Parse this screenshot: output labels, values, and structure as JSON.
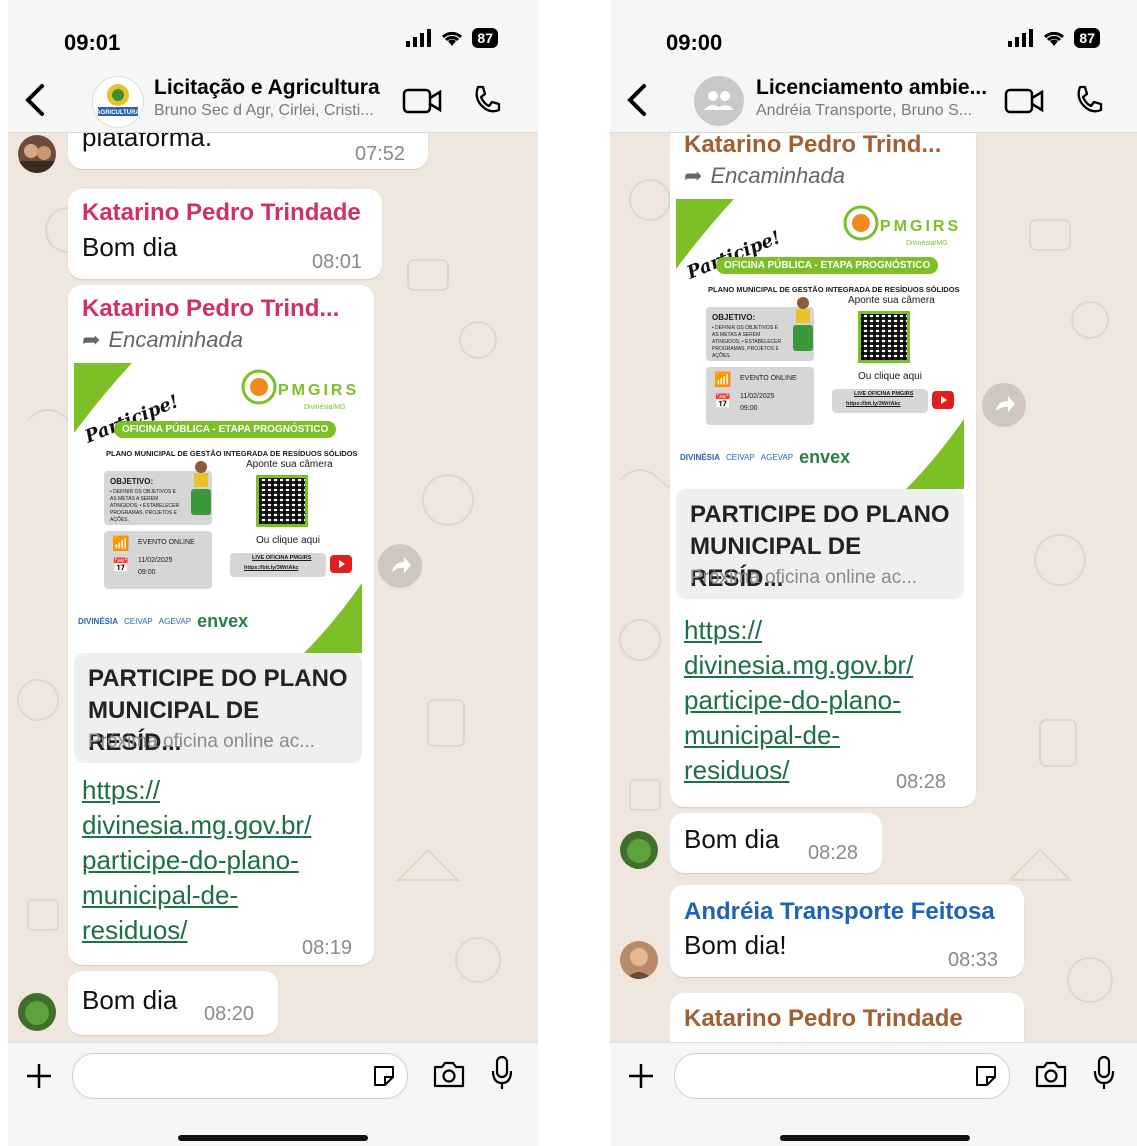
{
  "colors": {
    "accent_green": "#7dbf26",
    "link": "#1d6f45",
    "sender_pink": "#d0306a",
    "sender_blue": "#1f63b8",
    "sender_brown": "#a25f34",
    "chat_bg": "#efe7de"
  },
  "left": {
    "status": {
      "time": "09:01",
      "battery": "87"
    },
    "header": {
      "title": "Licitação e Agricultura",
      "subtitle": "Bruno Sec d Agr, Cirlei, Cristi...",
      "avatar_text": "AGRICULTURA"
    },
    "messages": {
      "m1_text": "plataforma.",
      "m1_time": "07:52",
      "m2_sender": "Katarino Pedro Trindade",
      "m2_text": "Bom dia",
      "m2_time": "08:01",
      "m3_sender": "Katarino Pedro Trind...",
      "m3_forwarded": "Encaminhada",
      "m3_link_title": "PARTICIPE DO PLANO MUNICIPAL DE RESÍD...",
      "m3_link_desc": "Próxima oficina online ac...",
      "m3_url": "https:// divinesia.mg.gov.br/ participe-do-plano- municipal-de- residuos/",
      "m3_time": "08:19",
      "m4_text": "Bom dia",
      "m4_time": "08:20"
    }
  },
  "right": {
    "status": {
      "time": "09:00",
      "battery": "87"
    },
    "header": {
      "title": "Licenciamento ambie...",
      "subtitle": "Andréia Transporte, Bruno S..."
    },
    "messages": {
      "m1_sender": "Katarino Pedro Trind...",
      "m1_forwarded": "Encaminhada",
      "m1_link_title": "PARTICIPE DO PLANO MUNICIPAL DE RESÍD...",
      "m1_link_desc": "Próxima oficina online ac...",
      "m1_url": "https:// divinesia.mg.gov.br/ participe-do-plano- municipal-de- residuos/",
      "m1_time": "08:28",
      "m2_text": "Bom dia",
      "m2_time": "08:28",
      "m3_sender": "Andréia Transporte Feitosa",
      "m3_text": "Bom dia!",
      "m3_time": "08:33",
      "m4_sender": "Katarino Pedro Trindade"
    }
  },
  "poster": {
    "brand": "PMGIRS",
    "brand_sub": "Divinésia/MG",
    "participe": "Participe!",
    "banner": "OFICINA PÚBLICA - ETAPA PROGNÓSTICO",
    "plan": "PLANO MUNICIPAL DE GESTÃO INTEGRADA DE RESÍDUOS SÓLIDOS",
    "objetivo_title": "OBJETIVO:",
    "objetivo_items": "• DEFINIR OS OBJETIVOS E AS METAS A SEREM ATINGIDOS; • ESTABELECER PROGRAMAS, PROJETOS E AÇÕES.",
    "camera": "Aponte sua câmera",
    "event": "EVENTO ONLINE",
    "date": "11/02/2025",
    "hour": "09:00",
    "click": "Ou clique aqui",
    "live": "LIVE OFICINA PMGIRS",
    "short_url": "https://bit.ly/3WrlAkc",
    "logos": [
      "DIVINÉSIA",
      "CEIVAP",
      "AGEVAP",
      "envex"
    ]
  },
  "footer": {
    "input_placeholder": ""
  }
}
